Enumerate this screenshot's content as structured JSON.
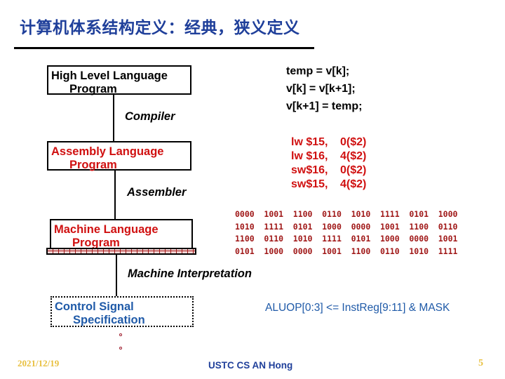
{
  "slide": {
    "title": "计算机体系结构定义：经典，狭义定义",
    "footer": {
      "date": "2021/12/19",
      "author": "USTC CS AN Hong",
      "page": "5"
    }
  },
  "hierarchy": {
    "high_level": {
      "line1": "High Level Language",
      "line2": "Program"
    },
    "compiler_label": "Compiler",
    "assembly": {
      "line1": "Assembly  Language",
      "line2": "Program"
    },
    "assembler_label": "Assembler",
    "machine": {
      "line1": "Machine  Language",
      "line2": "Program"
    },
    "interpretation_label": "Machine Interpretation",
    "control": {
      "line1": "Control Signal",
      "line2": "Specification"
    }
  },
  "examples": {
    "high_level_code": [
      "temp = v[k];",
      "v[k] = v[k+1];",
      "v[k+1] = temp;"
    ],
    "assembly_code": [
      {
        "op": "lw $15,",
        "arg": "0($2)"
      },
      {
        "op": "lw $16,",
        "arg": "4($2)"
      },
      {
        "op": "sw$16,",
        "arg": "0($2)"
      },
      {
        "op": "sw$15,",
        "arg": "4($2)"
      }
    ],
    "machine_code": [
      [
        "0000",
        "1001",
        "1100",
        "0110",
        "1010",
        "1111",
        "0101",
        "1000"
      ],
      [
        "1010",
        "1111",
        "0101",
        "1000",
        "0000",
        "1001",
        "1100",
        "0110"
      ],
      [
        "1100",
        "0110",
        "1010",
        "1111",
        "0101",
        "1000",
        "0000",
        "1001"
      ],
      [
        "0101",
        "1000",
        "0000",
        "1001",
        "1100",
        "0110",
        "1010",
        "1111"
      ]
    ],
    "control_rtl": "ALUOP[0:3] <= InstReg[9:11] & MASK"
  },
  "colors": {
    "title": "#1f3f9a",
    "assembly_red": "#d01010",
    "binary_red": "#a01818",
    "control_blue": "#1f5aa8",
    "footer_gold": "#e8c040"
  }
}
